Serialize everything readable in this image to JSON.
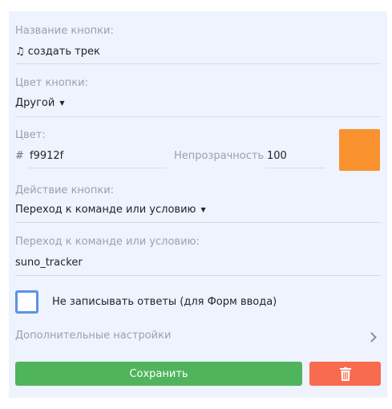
{
  "button_name": {
    "label": "Название кнопки:",
    "value": "♫ создать трек"
  },
  "button_color": {
    "label": "Цвет кнопки:",
    "value": "Другой"
  },
  "color": {
    "label": "Цвет:",
    "hash": "#",
    "hex_value": "f9912f",
    "opacity_label": "Непрозрачность",
    "opacity_value": "100",
    "swatch_color": "#f9912f"
  },
  "button_action": {
    "label": "Действие кнопки:",
    "value": "Переход к команде или условию"
  },
  "goto": {
    "label": "Переход к команде или условию:",
    "value": "suno_tracker"
  },
  "no_record": {
    "label": "Не записывать ответы (для Форм ввода)",
    "checked": false
  },
  "advanced": {
    "label": "Дополнительные настройки",
    "icon": "chevron-right-icon"
  },
  "actions": {
    "save_label": "Сохранить",
    "delete_icon": "trash-icon"
  },
  "colors": {
    "panel_bg": "#eef3fe",
    "save_green": "#4fb45c",
    "delete_red": "#f86b4f",
    "checkbox_blue": "#5b93e6"
  }
}
